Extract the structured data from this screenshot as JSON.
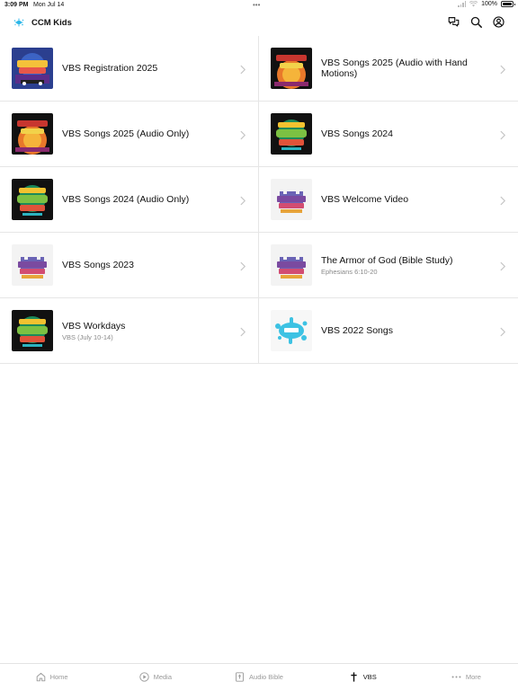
{
  "status_bar": {
    "time": "3:09 PM",
    "date": "Mon Jul 14",
    "multitask": "•••",
    "battery": "100%",
    "battery_level": 1.0
  },
  "app_bar": {
    "title": "CCM Kids",
    "logo_icon": "ccm-splash-logo-icon",
    "actions": [
      "chat-icon",
      "search-icon",
      "account-icon"
    ],
    "accent_color": "#29b6e8"
  },
  "items": [
    {
      "title": "VBS Registration 2025",
      "subtitle": "",
      "art": "wonder-junction"
    },
    {
      "title": "VBS Songs 2025 (Audio with Hand Motions)",
      "subtitle": "",
      "art": "sunrise-sunset"
    },
    {
      "title": "VBS Songs 2025 (Audio Only)",
      "subtitle": "",
      "art": "sunrise-sunset"
    },
    {
      "title": "VBS Songs 2024",
      "subtitle": "",
      "art": "jungle-journey"
    },
    {
      "title": "VBS Songs 2024 (Audio Only)",
      "subtitle": "",
      "art": "jungle-journey"
    },
    {
      "title": "VBS Welcome Video",
      "subtitle": "",
      "art": "keepers-kingdom"
    },
    {
      "title": "VBS Songs 2023",
      "subtitle": "",
      "art": "keepers-kingdom"
    },
    {
      "title": "The Armor of God (Bible Study)",
      "subtitle": "Ephesians 6:10-20",
      "art": "keepers-kingdom"
    },
    {
      "title": "VBS Workdays",
      "subtitle": "VBS (July 10-14)",
      "art": "jungle-journey"
    },
    {
      "title": "VBS 2022 Songs",
      "subtitle": "",
      "art": "splash"
    }
  ],
  "tabs": [
    {
      "label": "Home",
      "icon": "home-icon",
      "active": false
    },
    {
      "label": "Media",
      "icon": "play-circle-icon",
      "active": false
    },
    {
      "label": "Audio Bible",
      "icon": "bible-icon",
      "active": false
    },
    {
      "label": "VBS",
      "icon": "cross-icon",
      "active": true
    },
    {
      "label": "More",
      "icon": "more-dots-icon",
      "active": false
    }
  ]
}
